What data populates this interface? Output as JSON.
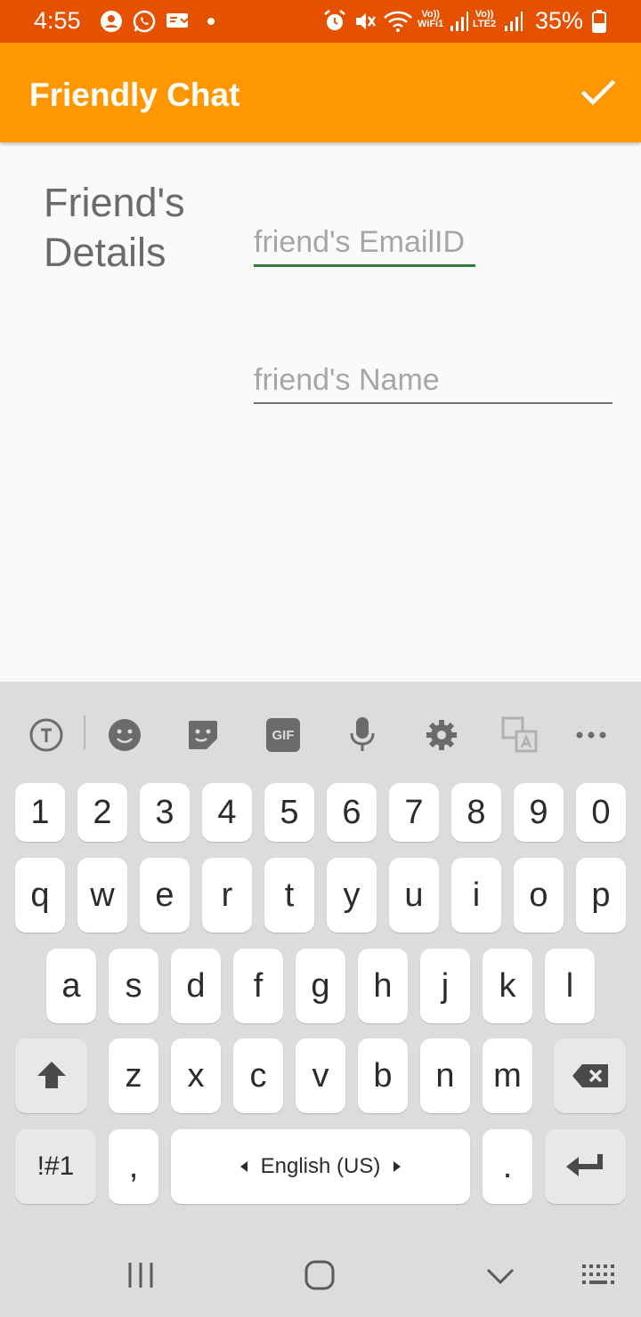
{
  "status_bar": {
    "time": "4:55",
    "battery_percent": "35%",
    "sim1_label_top": "Vo))",
    "sim1_label_bottom": "WiFi1",
    "sim2_label_top": "Vo))",
    "sim2_label_bottom": "LTE2"
  },
  "app_bar": {
    "title": "Friendly Chat",
    "confirm_icon": "checkmark-icon"
  },
  "form": {
    "section_label_line1": "Friend's",
    "section_label_line2": "Details",
    "email_field": {
      "placeholder": "friend's EmailID",
      "value": ""
    },
    "name_field": {
      "placeholder": "friend's Name",
      "value": ""
    }
  },
  "keyboard": {
    "number_row": [
      "1",
      "2",
      "3",
      "4",
      "5",
      "6",
      "7",
      "8",
      "9",
      "0"
    ],
    "row1": [
      "q",
      "w",
      "e",
      "r",
      "t",
      "y",
      "u",
      "i",
      "o",
      "p"
    ],
    "row2": [
      "a",
      "s",
      "d",
      "f",
      "g",
      "h",
      "j",
      "k",
      "l"
    ],
    "row3": [
      "z",
      "x",
      "c",
      "v",
      "b",
      "n",
      "m"
    ],
    "symbols_key": "!#1",
    "comma_key": ",",
    "period_key": ".",
    "space_key": "English (US)",
    "toolbar_icons": [
      "text-recognition-icon",
      "emoji-icon",
      "sticker-icon",
      "gif-icon",
      "microphone-icon",
      "settings-gear-icon",
      "translate-icon",
      "more-dots-icon"
    ],
    "gif_label": "GIF"
  },
  "nav_bar": {
    "icons": [
      "recents-icon",
      "home-icon",
      "back-icon",
      "keyboard-switch-icon"
    ]
  },
  "colors": {
    "status_bar": "#e65100",
    "app_bar": "#ff9800",
    "active_underline": "#2e7d32",
    "background": "#fafafa",
    "keyboard": "#dcdcdc"
  }
}
